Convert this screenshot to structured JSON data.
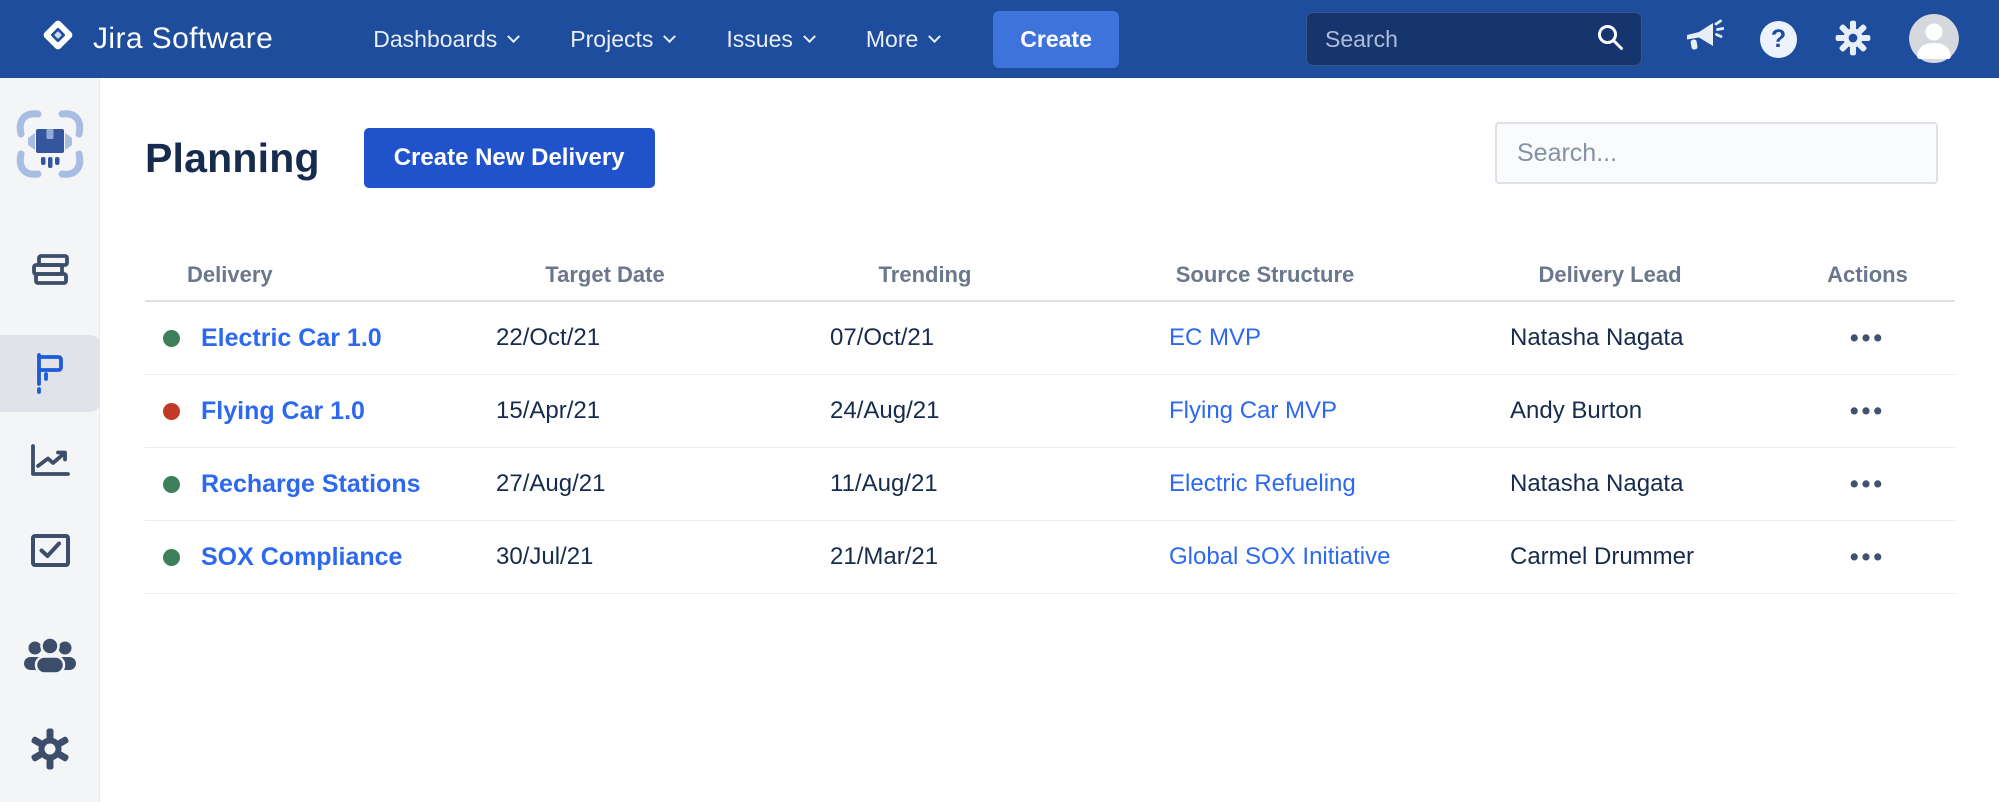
{
  "navbar": {
    "brand": "Jira Software",
    "menus": [
      {
        "label": "Dashboards"
      },
      {
        "label": "Projects"
      },
      {
        "label": "Issues"
      },
      {
        "label": "More"
      }
    ],
    "create_label": "Create",
    "search_placeholder": "Search",
    "help_glyph": "?"
  },
  "sidebar": {
    "items": [
      {
        "name": "delivery-app-logo",
        "active": false
      },
      {
        "name": "structure",
        "active": false
      },
      {
        "name": "planning-flag",
        "active": true
      },
      {
        "name": "reports-chart",
        "active": false
      },
      {
        "name": "tasks-checkbox",
        "active": false
      },
      {
        "name": "teams-people",
        "active": false
      },
      {
        "name": "settings-gear",
        "active": false
      }
    ]
  },
  "page": {
    "title": "Planning",
    "create_button": "Create New Delivery",
    "filter_placeholder": "Search..."
  },
  "table": {
    "columns": [
      "Delivery",
      "Target Date",
      "Trending",
      "Source Structure",
      "Delivery Lead",
      "Actions"
    ],
    "actions_glyph": "•••",
    "rows": [
      {
        "status": "green",
        "delivery": "Electric Car 1.0",
        "target_date": "22/Oct/21",
        "trending": "07/Oct/21",
        "source_structure": "EC MVP",
        "delivery_lead": "Natasha Nagata"
      },
      {
        "status": "red",
        "delivery": "Flying Car 1.0",
        "target_date": "15/Apr/21",
        "trending": "24/Aug/21",
        "source_structure": "Flying Car MVP",
        "delivery_lead": "Andy Burton"
      },
      {
        "status": "green",
        "delivery": "Recharge Stations",
        "target_date": "27/Aug/21",
        "trending": "11/Aug/21",
        "source_structure": "Electric Refueling",
        "delivery_lead": "Natasha Nagata"
      },
      {
        "status": "green",
        "delivery": "SOX Compliance",
        "target_date": "30/Jul/21",
        "trending": "21/Mar/21",
        "source_structure": "Global SOX Initiative",
        "delivery_lead": "Carmel Drummer"
      }
    ]
  },
  "colors": {
    "navbar_bg": "#1E4D9E",
    "navbar_create_button": "#3E73DC",
    "navbar_search_bg": "#16356E",
    "sidebar_bg": "#F4F5F7",
    "sidebar_selected_bg": "#E1E3E8",
    "primary_button": "#2053CB",
    "link_blue": "#2C68F0",
    "heading_text": "#172B4D",
    "table_header_text": "#6B778C",
    "status_green": "#3E7F5B",
    "status_red": "#C13A28"
  }
}
